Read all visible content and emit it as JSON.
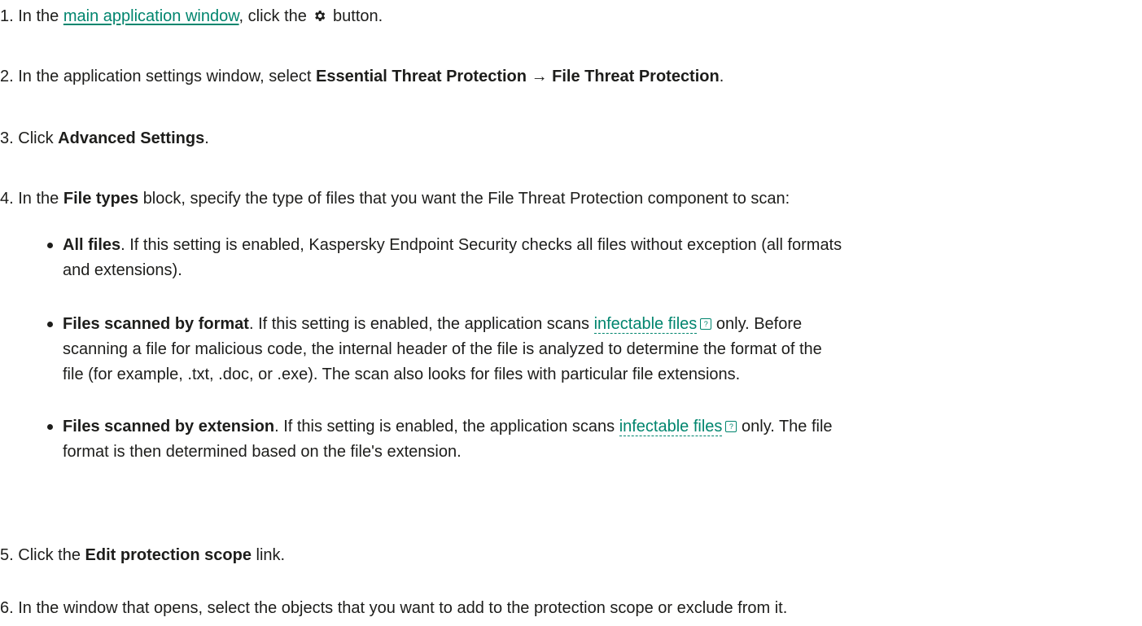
{
  "steps": [
    {
      "num": "1.",
      "t1": "In the",
      "link": "main application window",
      "t2": ", click the",
      "icon": "gear-icon",
      "t3": "button."
    },
    {
      "num": "2.",
      "t1": "In the application settings window, select",
      "b1": "Essential Threat Protection",
      "arrow": "→",
      "b2": "File Threat Protection",
      "t2": "."
    },
    {
      "num": "3.",
      "t1": "Click",
      "b1": "Advanced Settings",
      "t2": "."
    },
    {
      "num": "4.",
      "t1": "In the",
      "b1": "File types",
      "t2": "block, specify the type of files that you want the File Threat Protection component to scan:"
    },
    {
      "num": "5.",
      "t1": "Click the",
      "b1": "Edit protection scope",
      "t2": "link."
    },
    {
      "num": "6.",
      "t1": "In the window that opens, select the objects that you want to add to the protection scope or exclude from it."
    }
  ],
  "file_types": [
    {
      "title": "All files",
      "line1": ". If this setting is enabled, Kaspersky Endpoint Security checks all files without exception (all formats",
      "line2": "and extensions)."
    },
    {
      "title": "Files scanned by format",
      "t1": ". If this setting is enabled, the application scans",
      "link": "infectable files",
      "t2": "only. Before",
      "line2": "scanning a file for malicious code, the internal header of the file is analyzed to determine the format of the",
      "line3": "file (for example, .txt, .doc, or .exe). The scan also looks for files with particular file extensions."
    },
    {
      "title": "Files scanned by extension",
      "t1": ". If this setting is enabled, the application scans",
      "link": "infectable files",
      "t2": "only. The file",
      "line2": "format is then determined based on the file's extension."
    }
  ],
  "icons": {
    "help": "?",
    "help_icon": "help-icon",
    "gear": "gear-icon"
  },
  "colors": {
    "link": "#00856e",
    "text": "#1d1d1b"
  }
}
